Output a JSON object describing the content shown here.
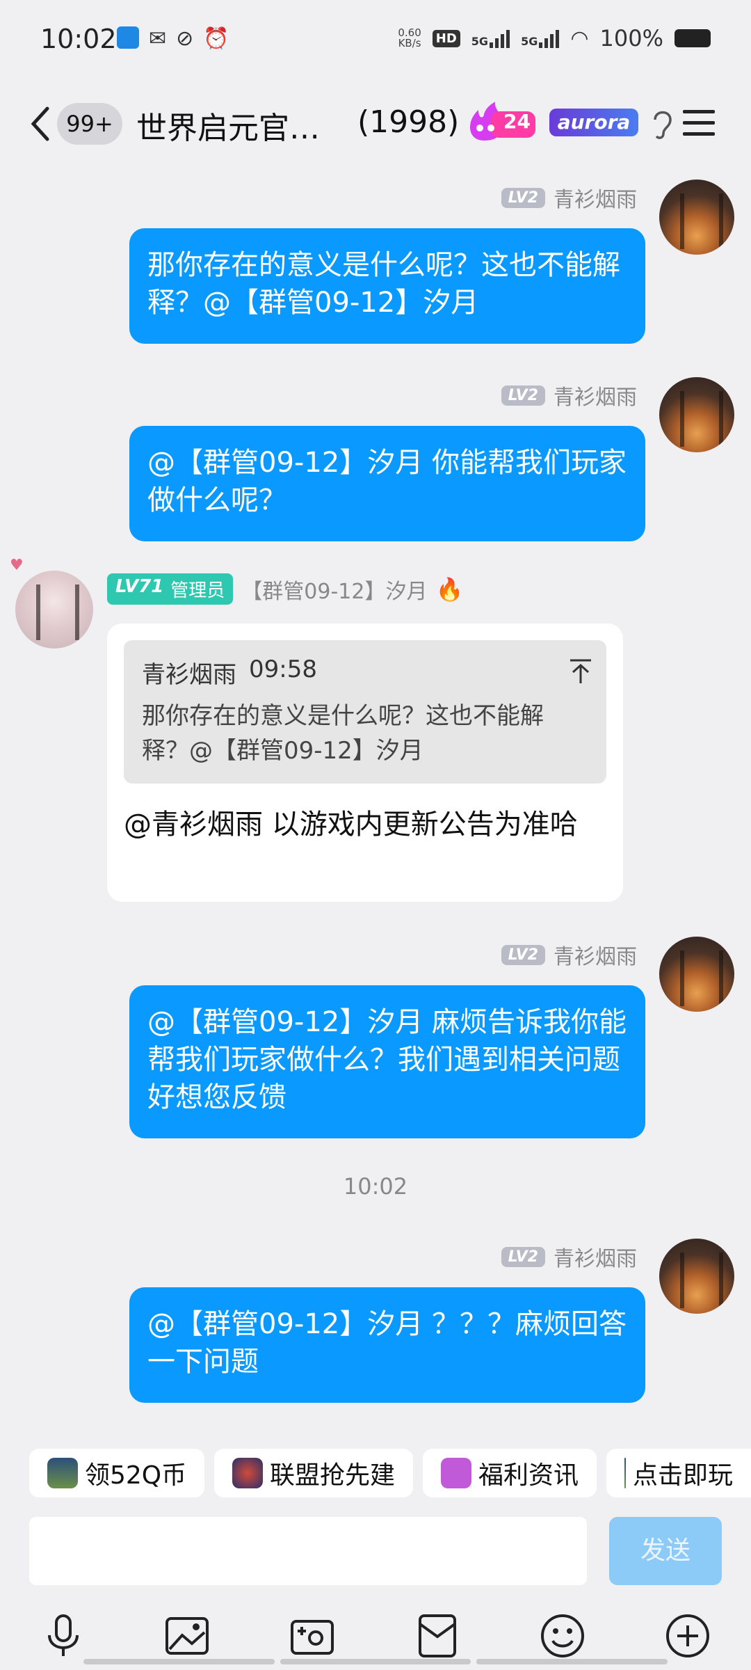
{
  "status_bar": {
    "time": "10:02",
    "net_speed": "0.60",
    "net_unit": "KB/s",
    "hd": "HD",
    "sig1": "5G",
    "sig2": "5G",
    "battery": "100%"
  },
  "nav": {
    "unread": "99+",
    "title": "世界启元官…",
    "member_count": "(1998)",
    "fire_level": "24",
    "brand_badge": "aurora"
  },
  "messages": [
    {
      "sender": "青衫烟雨",
      "level": "LV2",
      "text": "那你存在的意义是什么呢？这也不能解释？@【群管09-12】汐月"
    },
    {
      "sender": "青衫烟雨",
      "level": "LV2",
      "text": "@【群管09-12】汐月  你能帮我们玩家做什么呢？"
    },
    {
      "sender": "【群管09-12】汐月",
      "level": "LV71",
      "role": "管理员",
      "quote": {
        "sender": "青衫烟雨",
        "time": "09:58",
        "text": "那你存在的意义是什么呢？这也不能解释？@【群管09-12】汐月"
      },
      "text": "@青衫烟雨  以游戏内更新公告为准哈"
    },
    {
      "sender": "青衫烟雨",
      "level": "LV2",
      "text": "@【群管09-12】汐月  麻烦告诉我你能帮我们玩家做什么？我们遇到相关问题好想您反馈"
    },
    {
      "timestamp": "10:02"
    },
    {
      "sender": "青衫烟雨",
      "level": "LV2",
      "text": "@【群管09-12】汐月  ？？？麻烦回答一下问题"
    }
  ],
  "quick_actions": [
    "领52Q币",
    "联盟抢先建",
    "福利资讯",
    "点击即玩"
  ],
  "input": {
    "placeholder": "",
    "send_label": "发送"
  },
  "toolbar": [
    "mic-icon",
    "image-icon",
    "camera-icon",
    "red-packet-icon",
    "emoji-icon",
    "plus-icon"
  ],
  "colors": {
    "bubble_blue": "#0a99ff",
    "send_disabled": "#8ccbf7",
    "admin_badge": "#2ec7b0"
  }
}
